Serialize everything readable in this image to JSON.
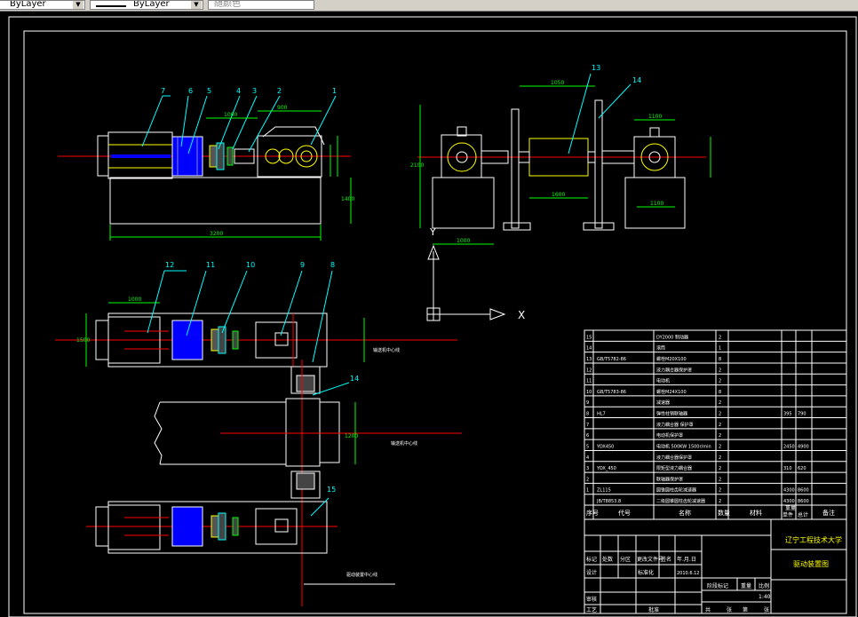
{
  "toolbar": {
    "linetype_value": "ByLayer",
    "lineweight_value": "ByLayer",
    "color_value": "随颜色"
  },
  "drawing": {
    "axis_y_label": "Y",
    "axis_x_label": "X",
    "balloons_top": [
      "7",
      "6",
      "5",
      "4",
      "3",
      "2",
      "1"
    ],
    "balloons_plan": [
      "12",
      "11",
      "10",
      "9",
      "8"
    ],
    "balloons_side": [
      "13",
      "14"
    ],
    "balloon_mid": "14",
    "balloon_bottom": "15",
    "dims": {
      "top_overall": "3200",
      "top_height": "1400",
      "top_b1": "1000",
      "top_b2": "900",
      "side_top": "1050",
      "side_h": "2100",
      "side_w": "1600",
      "side_base": "1000",
      "side_left": "1100",
      "side_right": "1100",
      "plan_a": "1500",
      "plan_b": "1000",
      "plan_mid": "1200"
    },
    "notes": {
      "centerline_1": "输送机中心线",
      "centerline_2": "输送机中心线",
      "centerline_3": "驱动装置中心线"
    }
  },
  "title_block": {
    "company": "辽宁工程技术大学",
    "drawing_name": "驱动装置图",
    "headers": [
      "序号",
      "代号",
      "名称",
      "数量",
      "材料",
      "单件",
      "总计",
      "备注"
    ],
    "header_weight": "重量",
    "rows": [
      {
        "no": "15",
        "code": "",
        "name": "DY2000 制动器",
        "qty": "2",
        "mat": "",
        "w1": "",
        "w2": ""
      },
      {
        "no": "14",
        "code": "",
        "name": "滚筒",
        "qty": "1",
        "mat": "",
        "w1": "",
        "w2": ""
      },
      {
        "no": "13",
        "code": "GB/T5782-86",
        "name": "螺栓M20X100",
        "qty": "8",
        "mat": "",
        "w1": "",
        "w2": ""
      },
      {
        "no": "12",
        "code": "",
        "name": "液力耦合器保护罩",
        "qty": "2",
        "mat": "",
        "w1": "",
        "w2": ""
      },
      {
        "no": "11",
        "code": "",
        "name": "电动机",
        "qty": "2",
        "mat": "",
        "w1": "",
        "w2": ""
      },
      {
        "no": "10",
        "code": "GB/T5783-86",
        "name": "螺栓M24X100",
        "qty": "8",
        "mat": "",
        "w1": "",
        "w2": ""
      },
      {
        "no": "9",
        "code": "",
        "name": "减速器",
        "qty": "2",
        "mat": "",
        "w1": "",
        "w2": ""
      },
      {
        "no": "8",
        "code": "HL7",
        "name": "弹性柱销联轴器",
        "qty": "2",
        "mat": "",
        "w1": "395",
        "w2": "790"
      },
      {
        "no": "7",
        "code": "",
        "name": "液力耦合器 保护罩",
        "qty": "2",
        "mat": "",
        "w1": "",
        "w2": ""
      },
      {
        "no": "6",
        "code": "",
        "name": "电动机保护罩",
        "qty": "2",
        "mat": "",
        "w1": "",
        "w2": ""
      },
      {
        "no": "5",
        "code": "YOX450",
        "name": "电动机 500KW 1500r/min",
        "qty": "2",
        "mat": "",
        "w1": "2450",
        "w2": "4900"
      },
      {
        "no": "4",
        "code": "",
        "name": "液力耦合器保护罩",
        "qty": "2",
        "mat": "",
        "w1": "",
        "w2": ""
      },
      {
        "no": "3",
        "code": "YOX_450",
        "name": "限矩型液力耦合器",
        "qty": "2",
        "mat": "",
        "w1": "310",
        "w2": "620"
      },
      {
        "no": "2",
        "code": "",
        "name": "联轴器保护罩",
        "qty": "2",
        "mat": "",
        "w1": "",
        "w2": ""
      },
      {
        "no": "1",
        "code": "ZL115",
        "name": "圆锥圆柱齿轮减速器",
        "qty": "2",
        "mat": "",
        "w1": "4300",
        "w2": "8600"
      },
      {
        "no": "",
        "code": "JB/T8853.8",
        "name": "二级圆锥圆柱齿轮减速器",
        "qty": "2",
        "mat": "",
        "w1": "4300",
        "w2": "8600"
      }
    ],
    "sign_labels": [
      "标记",
      "处数",
      "分区",
      "更改文件号",
      "签名",
      "年.月.日"
    ],
    "design_label": "设计",
    "standard_label": "标准化",
    "stage_label": "阶段标记",
    "weight_label": "重量",
    "scale_label": "比例",
    "scale_value": "1:40",
    "review_label": "审核",
    "craft_label": "工艺",
    "approve_label": "批准",
    "sheet_total": "共",
    "sheet_label": "张",
    "sheet_no": "第",
    "date_value": "2010.6.12"
  }
}
